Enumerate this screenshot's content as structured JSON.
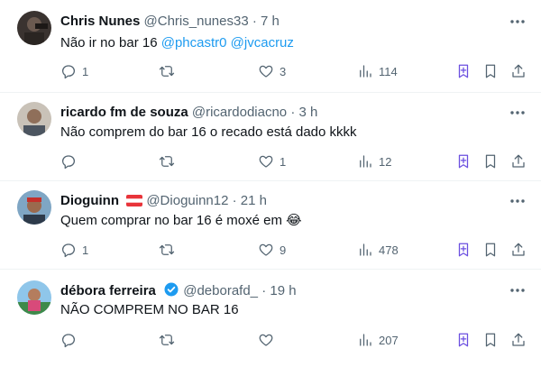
{
  "colors": {
    "accent": "#1d9bf0",
    "muted": "#536471",
    "grok": "#6b4fe0",
    "divider": "#eff3f4"
  },
  "tweets": [
    {
      "name": "Chris Nunes",
      "handle": "@Chris_nunes33",
      "sep": "·",
      "time": "7 h",
      "text_plain": "Não ir no bar 16 ",
      "mentions": "@phcastr0 @jvcacruz",
      "badge": null,
      "replies": "1",
      "retweets": "",
      "likes": "3",
      "views": "114",
      "icons": [
        "reply-icon",
        "retweet-icon",
        "like-icon",
        "views-icon",
        "grok-icon",
        "bookmark-icon",
        "share-icon",
        "more-icon"
      ]
    },
    {
      "name": "ricardo fm de souza",
      "handle": "@ricardodiacno",
      "sep": "·",
      "time": "3 h",
      "text_plain": "Não comprem do bar 16 o recado está dado kkkk",
      "mentions": "",
      "badge": null,
      "replies": "",
      "retweets": "",
      "likes": "1",
      "views": "12"
    },
    {
      "name": "Dioguinn",
      "handle": "@Dioguinn12",
      "sep": "·",
      "time": "21 h",
      "text_plain": "Quem comprar no bar 16 é moxé em ",
      "emoji": "😂",
      "mentions": "",
      "badge": "austria-flag",
      "replies": "1",
      "retweets": "",
      "likes": "9",
      "views": "478"
    },
    {
      "name": "débora ferreira",
      "handle": "@deborafd_",
      "sep": "·",
      "time": "19 h",
      "text_plain": "NÃO COMPREM NO BAR 16",
      "mentions": "",
      "badge": "verified-badge",
      "replies": "",
      "retweets": "",
      "likes": "",
      "views": "207"
    }
  ]
}
